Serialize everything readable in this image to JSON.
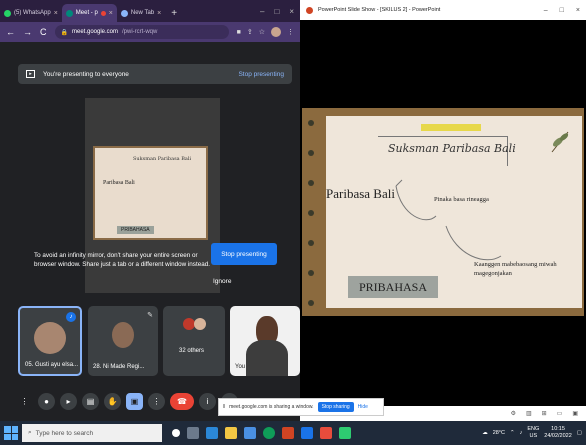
{
  "chrome": {
    "tabs": [
      {
        "label": "(5) WhatsApp",
        "color": "#25d366"
      },
      {
        "label": "Meet - p",
        "color": "#00897b"
      },
      {
        "label": "New Tab",
        "color": "#8ab4f8"
      }
    ],
    "url_host": "meet.google.com",
    "url_path": "/pwi-rcrt-wqw"
  },
  "presenting": {
    "banner_text": "You're presenting to everyone",
    "stop_link": "Stop presenting",
    "mirror_text": "To avoid an infinity mirror, don't share your entire screen or browser window. Share just a tab or a different window instead.",
    "stop_button": "Stop presenting",
    "ignore_button": "Ignore"
  },
  "preview": {
    "title": "Suksman Paribasa Bali",
    "left_label": "Paribasa Bali",
    "box_label": "PRIBAHASA"
  },
  "participants": [
    {
      "name": "05. Gusti ayu elsa..."
    },
    {
      "name": "28. Ni Made Regi..."
    },
    {
      "name": "32 others"
    },
    {
      "name": "You"
    }
  ],
  "share_bar": {
    "text": "meet.google.com is sharing a window.",
    "stop": "Stop sharing",
    "hide": "Hide"
  },
  "ppt": {
    "window_title": "PowerPoint Slide Show - [SKILUS 2] - PowerPoint",
    "slide": {
      "title": "Suksman Paribasa Bali",
      "paribasa": "Paribasa Bali",
      "pinaka": "Pinaka basa rineagga",
      "kaanggen": "Kaanggen mabebaosang miwah magegonjakan",
      "pribahasa": "PRIBAHASA"
    }
  },
  "taskbar": {
    "search_placeholder": "Type here to search",
    "weather": "28°C",
    "lang": "ENG",
    "region": "US",
    "time": "10:15",
    "date": "24/02/2022"
  }
}
